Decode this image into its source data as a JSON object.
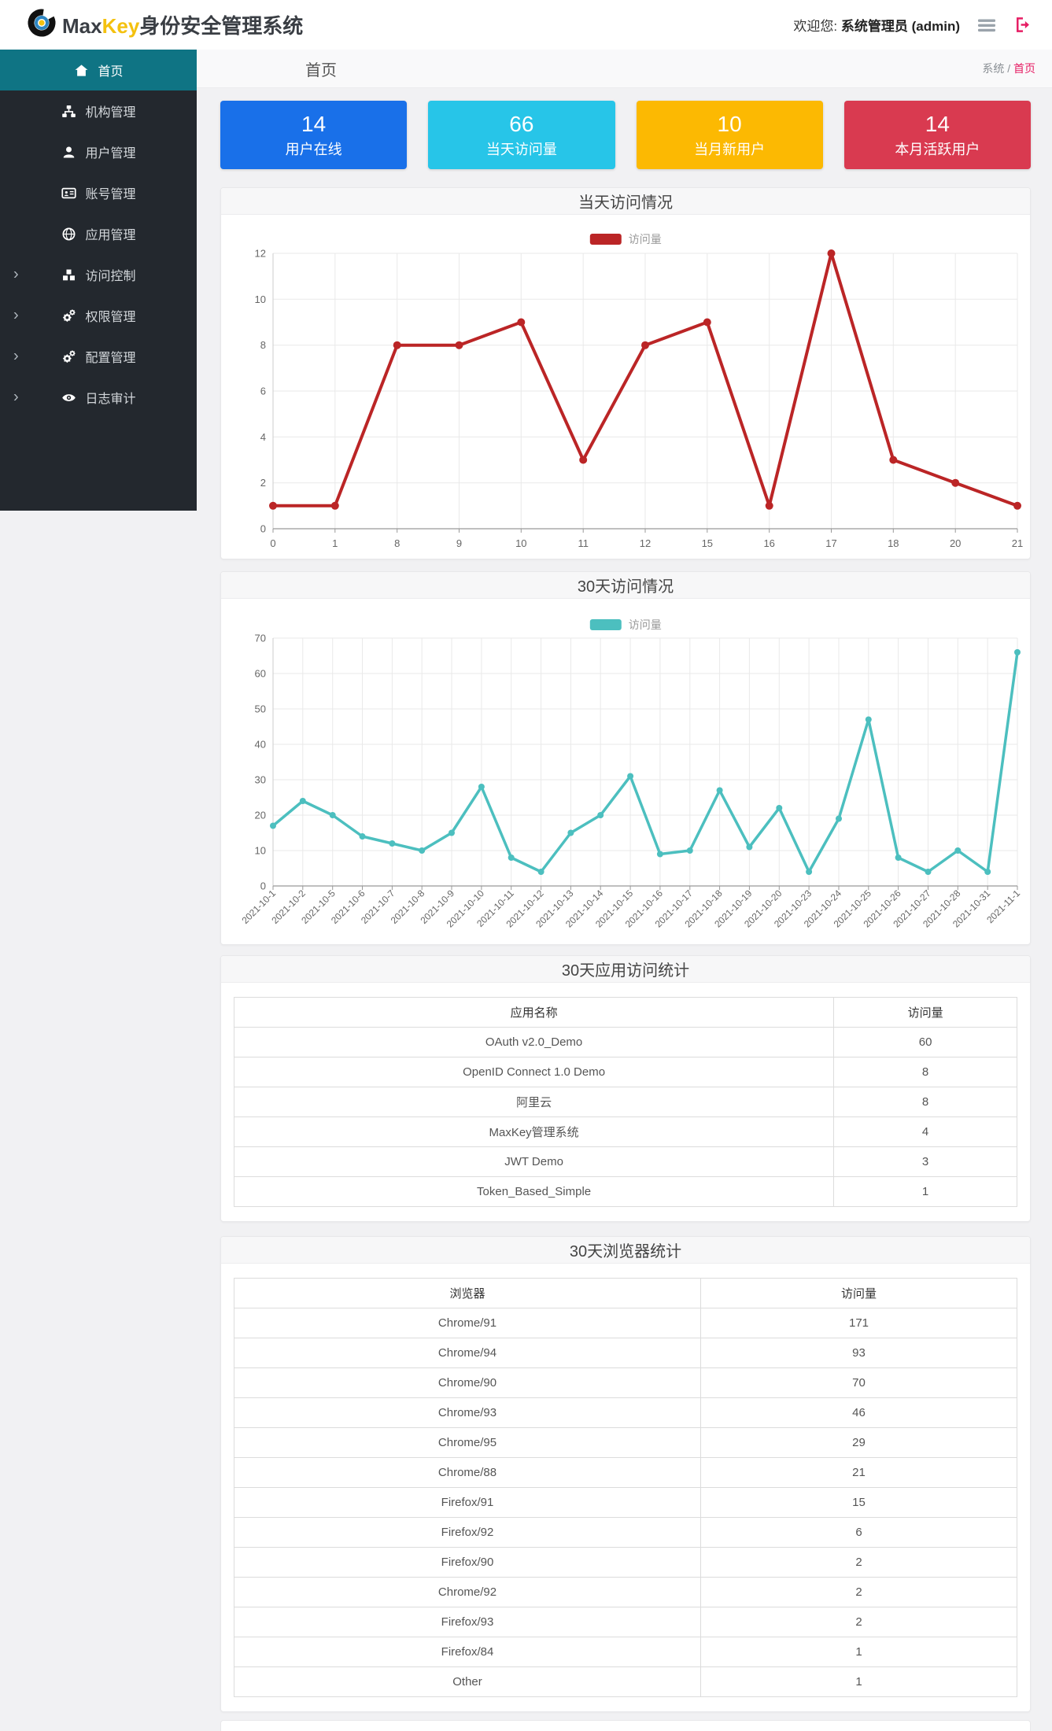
{
  "header": {
    "brand_max": "Max",
    "brand_key": "Key",
    "brand_suffix": "身份安全管理系统",
    "welcome_prefix": "欢迎您:",
    "user": "系统管理员 (admin)",
    "menu_icon": "hamburger-icon",
    "logout_icon": "sign-out-icon",
    "logout_color": "#e61e64"
  },
  "sidebar": {
    "background": "#23282e",
    "active_background": "#0f7484",
    "items": [
      {
        "label": "首页",
        "icon": "home-icon",
        "active": true,
        "expandable": false
      },
      {
        "label": "机构管理",
        "icon": "sitemap-icon",
        "active": false,
        "expandable": false
      },
      {
        "label": "用户管理",
        "icon": "user-icon",
        "active": false,
        "expandable": false
      },
      {
        "label": "账号管理",
        "icon": "id-card-icon",
        "active": false,
        "expandable": false
      },
      {
        "label": "应用管理",
        "icon": "globe-icon",
        "active": false,
        "expandable": false
      },
      {
        "label": "访问控制",
        "icon": "cubes-icon",
        "active": false,
        "expandable": true
      },
      {
        "label": "权限管理",
        "icon": "cogs-icon",
        "active": false,
        "expandable": true
      },
      {
        "label": "配置管理",
        "icon": "cogs-icon",
        "active": false,
        "expandable": true
      },
      {
        "label": "日志审计",
        "icon": "eye-icon",
        "active": false,
        "expandable": true
      }
    ]
  },
  "breadcrumb": {
    "title": "首页",
    "path_root": "系统",
    "path_separator": "/",
    "path_current": "首页"
  },
  "stat_cards": [
    {
      "value": "14",
      "label": "用户在线",
      "color": "#1970e9"
    },
    {
      "value": "66",
      "label": "当天访问量",
      "color": "#27c5e8"
    },
    {
      "value": "10",
      "label": "当月新用户",
      "color": "#fcb902"
    },
    {
      "value": "14",
      "label": "本月活跃用户",
      "color": "#d93a50"
    }
  ],
  "panels": {
    "daily": {
      "title": "当天访问情况"
    },
    "monthly": {
      "title": "30天访问情况"
    },
    "apps": {
      "title": "30天应用访问统计"
    },
    "browsers": {
      "title": "30天浏览器统计"
    }
  },
  "chart_data": [
    {
      "type": "line",
      "title": "当天访问情况",
      "legend": "访问量",
      "legend_position": "top-center",
      "color": "#bb2526",
      "categories": [
        "0",
        "1",
        "8",
        "9",
        "10",
        "11",
        "12",
        "15",
        "16",
        "17",
        "18",
        "20",
        "21"
      ],
      "values": [
        1,
        1,
        8,
        8,
        9,
        3,
        8,
        9,
        1,
        12,
        3,
        2,
        1
      ],
      "xlabel": "",
      "ylabel": "",
      "ylim": [
        0,
        12
      ],
      "ytick": 2,
      "grid": true,
      "x_label_rotate": 0
    },
    {
      "type": "line",
      "title": "30天访问情况",
      "legend": "访问量",
      "legend_position": "top-center",
      "color": "#4cbfbf",
      "categories": [
        "2021-10-1",
        "2021-10-2",
        "2021-10-5",
        "2021-10-6",
        "2021-10-7",
        "2021-10-8",
        "2021-10-9",
        "2021-10-10",
        "2021-10-11",
        "2021-10-12",
        "2021-10-13",
        "2021-10-14",
        "2021-10-15",
        "2021-10-16",
        "2021-10-17",
        "2021-10-18",
        "2021-10-19",
        "2021-10-20",
        "2021-10-23",
        "2021-10-24",
        "2021-10-25",
        "2021-10-26",
        "2021-10-27",
        "2021-10-28",
        "2021-10-31",
        "2021-11-1"
      ],
      "values": [
        17,
        24,
        20,
        14,
        12,
        10,
        15,
        28,
        8,
        4,
        15,
        20,
        31,
        9,
        10,
        27,
        11,
        22,
        4,
        19,
        47,
        8,
        4,
        10,
        4,
        66
      ],
      "xlabel": "",
      "ylabel": "",
      "ylim": [
        0,
        70
      ],
      "ytick": 10,
      "grid": true,
      "x_label_rotate": 45
    }
  ],
  "tables": {
    "apps": {
      "headers": [
        "应用名称",
        "访问量"
      ],
      "rows": [
        [
          "OAuth v2.0_Demo",
          "60"
        ],
        [
          "OpenID Connect 1.0 Demo",
          "8"
        ],
        [
          "阿里云",
          "8"
        ],
        [
          "MaxKey管理系统",
          "4"
        ],
        [
          "JWT Demo",
          "3"
        ],
        [
          "Token_Based_Simple",
          "1"
        ]
      ]
    },
    "browsers": {
      "headers": [
        "浏览器",
        "访问量"
      ],
      "rows": [
        [
          "Chrome/91",
          "171"
        ],
        [
          "Chrome/94",
          "93"
        ],
        [
          "Chrome/90",
          "70"
        ],
        [
          "Chrome/93",
          "46"
        ],
        [
          "Chrome/95",
          "29"
        ],
        [
          "Chrome/88",
          "21"
        ],
        [
          "Firefox/91",
          "15"
        ],
        [
          "Firefox/92",
          "6"
        ],
        [
          "Firefox/90",
          "2"
        ],
        [
          "Chrome/92",
          "2"
        ],
        [
          "Firefox/93",
          "2"
        ],
        [
          "Firefox/84",
          "1"
        ],
        [
          "Other",
          "1"
        ]
      ]
    }
  }
}
